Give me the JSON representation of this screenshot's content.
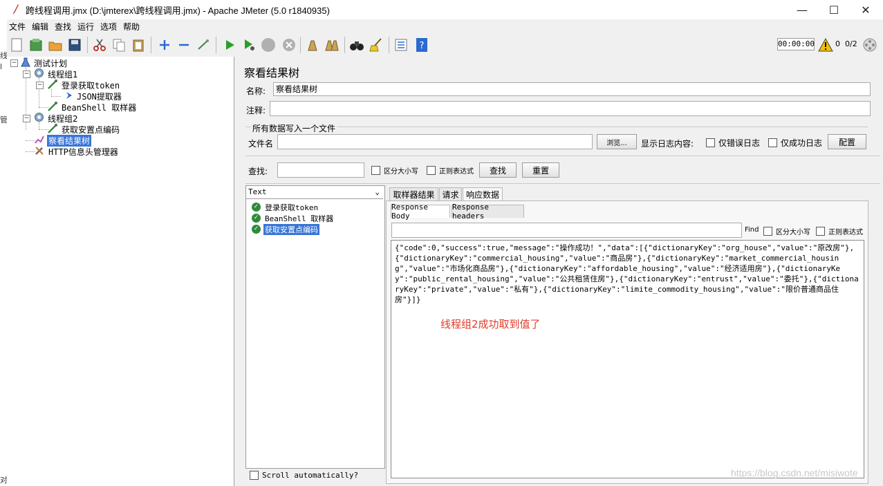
{
  "window": {
    "title": "跨线程调用.jmx (D:\\jmterex\\跨线程调用.jmx) - Apache JMeter (5.0 r1840935)",
    "minimize": "—",
    "maximize": "☐",
    "close": "✕"
  },
  "left_strip": [
    "线",
    "l",
    "管",
    "对"
  ],
  "menu": [
    "文件",
    "编辑",
    "查找",
    "运行",
    "选项",
    "帮助"
  ],
  "toolbar": {
    "timer": "00:00:00",
    "warning_count": "0",
    "threads": "0/2"
  },
  "tree": {
    "items": [
      {
        "label": "测试计划"
      },
      {
        "label": "线程组1"
      },
      {
        "label": "登录获取token"
      },
      {
        "label": "JSON提取器"
      },
      {
        "label": "BeanShell 取样器"
      },
      {
        "label": "线程组2"
      },
      {
        "label": "获取安置点编码"
      },
      {
        "label": "察看结果树"
      },
      {
        "label": "HTTP信息头管理器"
      }
    ]
  },
  "panel": {
    "title": "察看结果树",
    "name_label": "名称:",
    "name_value": "察看结果树",
    "comment_label": "注释:",
    "write_all_label": "所有数据写入一个文件",
    "filename_label": "文件名",
    "browse_button": "浏览...",
    "log_label": "显示日志内容:",
    "errors_only": "仅错误日志",
    "success_only": "仅成功日志",
    "configure_button": "配置",
    "search_label": "查找:",
    "case_sensitive": "区分大小写",
    "regex": "正则表达式",
    "search_button": "查找",
    "reset_button": "重置"
  },
  "results": {
    "renderer": "Text",
    "items": [
      {
        "label": "登录获取token"
      },
      {
        "label": "BeanShell 取样器"
      },
      {
        "label": "获取安置点编码"
      }
    ],
    "scroll_auto": "Scroll automatically?"
  },
  "tabs": [
    "取样器结果",
    "请求",
    "响应数据"
  ],
  "subtabs": [
    "Response Body",
    "Response headers"
  ],
  "find": {
    "label": "Find",
    "case_sensitive": "区分大小写",
    "regex": "正则表达式"
  },
  "response_body": "{\"code\":0,\"success\":true,\"message\":\"操作成功！\",\"data\":[{\"dictionaryKey\":\"org_house\",\"value\":\"原改房\"},{\"dictionaryKey\":\"commercial_housing\",\"value\":\"商品房\"},{\"dictionaryKey\":\"market_commercial_housing\",\"value\":\"市场化商品房\"},{\"dictionaryKey\":\"affordable_housing\",\"value\":\"经济适用房\"},{\"dictionaryKey\":\"public_rental_housing\",\"value\":\"公共租赁住房\"},{\"dictionaryKey\":\"entrust\",\"value\":\"委托\"},{\"dictionaryKey\":\"private\",\"value\":\"私有\"},{\"dictionaryKey\":\"limite_commodity_housing\",\"value\":\"限价普通商品住房\"}]}",
  "annotation": "线程组2成功取到值了",
  "watermark": "https://blog.csdn.net/misiwote"
}
